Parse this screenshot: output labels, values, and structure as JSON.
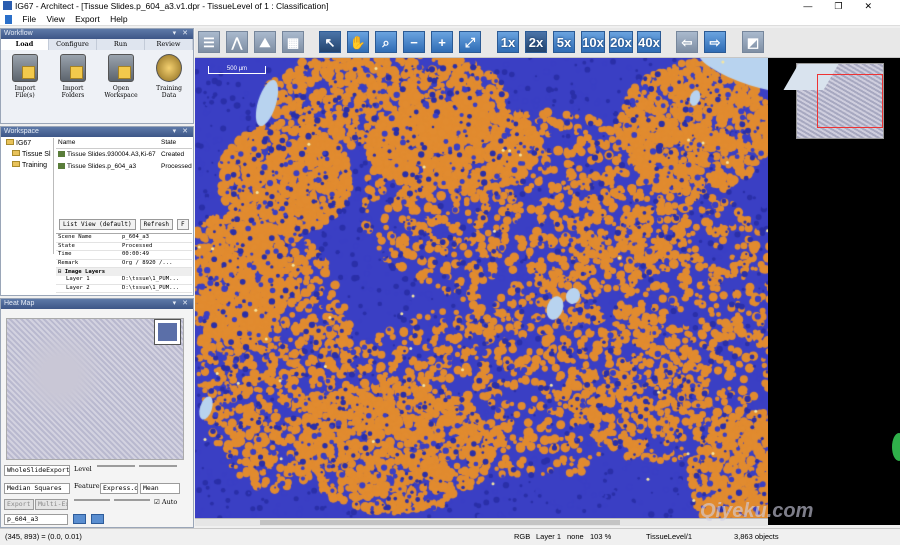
{
  "window": {
    "title": "IG67 - Architect - [Tissue Slides.p_604_a3.v1.dpr - TissueLevel of 1 : Classification]",
    "controls": [
      "—",
      "❐",
      "✕"
    ]
  },
  "menu": [
    "File",
    "View",
    "Export",
    "Help"
  ],
  "workflow": {
    "header": "Workflow",
    "tabs": [
      "Load",
      "Configure",
      "Run",
      "Review"
    ],
    "active_tab": "Load",
    "tools": [
      "Import File(s)",
      "Import Folders",
      "Open Workspace",
      "Training Data"
    ]
  },
  "workspace": {
    "header": "Workspace",
    "tree": [
      "IG67",
      "Tissue Sl",
      "Training"
    ],
    "columns": [
      "Name",
      "State"
    ],
    "rows": [
      {
        "name": "Tissue Slides.930004.A3,Ki-67",
        "state": "Created"
      },
      {
        "name": "Tissue Slides.p_604_a3",
        "state": "Processed"
      }
    ],
    "list_view": "List View (default)",
    "refresh": "Refresh",
    "extra_btn": "F",
    "props": [
      {
        "k": "Scene Name",
        "v": "p_604_a3"
      },
      {
        "k": "State",
        "v": "Processed"
      },
      {
        "k": "Time",
        "v": "00:00:49"
      },
      {
        "k": "Remark",
        "v": "Org / 8920 /..."
      }
    ],
    "image_layers_title": "Image Layers",
    "layers": [
      {
        "k": "Layer 1",
        "v": "D:\\tssue\\1_PUM..."
      },
      {
        "k": "Layer 2",
        "v": "D:\\tssue\\1_PUM..."
      }
    ]
  },
  "heatmap": {
    "header": "Heat Map",
    "export_select": "WholeSlideExport",
    "level_label": "Level",
    "level_value": "",
    "measure_select": "Median Squares",
    "feature_label": "Feature",
    "feature_value": "Express.ons",
    "stat_value": "Mean",
    "export_btn": "Export",
    "multi_export_btn": "Multi-Export",
    "auto_label": "Auto",
    "auto_checked": true,
    "scene_field": "p_604_a3"
  },
  "toolbar": {
    "zoom_buttons": [
      "1x",
      "2x",
      "5x",
      "10x",
      "20x",
      "40x"
    ],
    "icons": [
      "split-h-icon",
      "draw-icon",
      "image-icon",
      "grid-icon",
      "pointer-icon",
      "hand-icon",
      "zoom-icon",
      "zoom-out-icon",
      "zoom-in-icon",
      "fit-icon",
      "back-icon",
      "forward-icon",
      "overview-icon"
    ]
  },
  "viewer": {
    "scalebar": "500 µm",
    "colors": {
      "background_class": "#3a3fc4",
      "tumor_class": "#e18b2f",
      "lumen_class": "#b8d3ef",
      "detail": "#f4e6a2"
    }
  },
  "status": {
    "coords": "(345, 893) = (0.0, 0.01)",
    "mode": "RGB",
    "layer": "Layer 1",
    "none": "none",
    "zoom": "103 %",
    "level": "TissueLevel/1",
    "objects": "3,863 objects"
  },
  "watermark": "Qiyeku.com"
}
